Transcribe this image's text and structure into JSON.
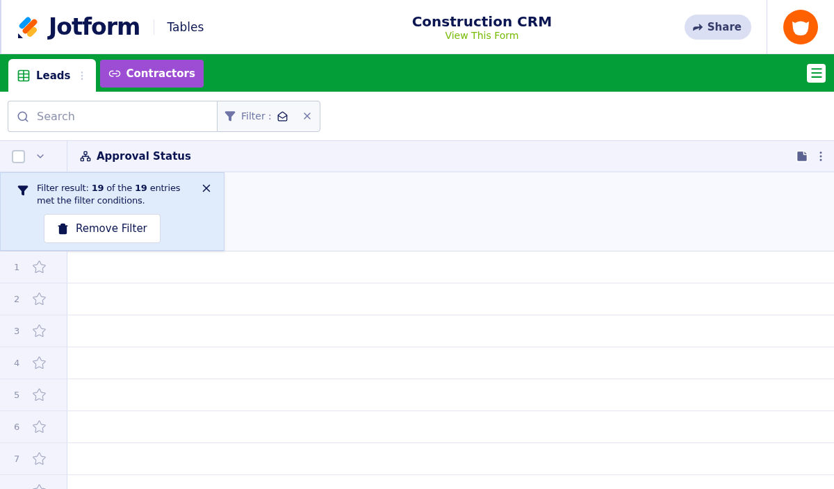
{
  "header": {
    "brand": "Jotform",
    "product": "Tables",
    "title": "Construction CRM",
    "subtitle": "View This Form",
    "share_button": "Share"
  },
  "tabs": [
    {
      "label": "Leads",
      "kind": "table",
      "selected": true
    },
    {
      "label": "Contractors",
      "kind": "link",
      "selected": false
    }
  ],
  "toolbar": {
    "search": {
      "placeholder": "Search"
    },
    "filter_label": "Filter :"
  },
  "table": {
    "columns": [
      {
        "label": "Approval Status"
      }
    ],
    "select_all_checked": false,
    "filter_notice": {
      "text": "Filter result: **19** of the **19** entries met the filter conditions.",
      "button": "Remove Filter"
    },
    "rows": [
      {
        "number": "1",
        "starred": false
      },
      {
        "number": "2",
        "starred": false
      },
      {
        "number": "3",
        "starred": false
      },
      {
        "number": "4",
        "starred": false
      },
      {
        "number": "5",
        "starred": false
      },
      {
        "number": "6",
        "starred": false
      },
      {
        "number": "7",
        "starred": false
      },
      {
        "starred": false
      }
    ]
  }
}
